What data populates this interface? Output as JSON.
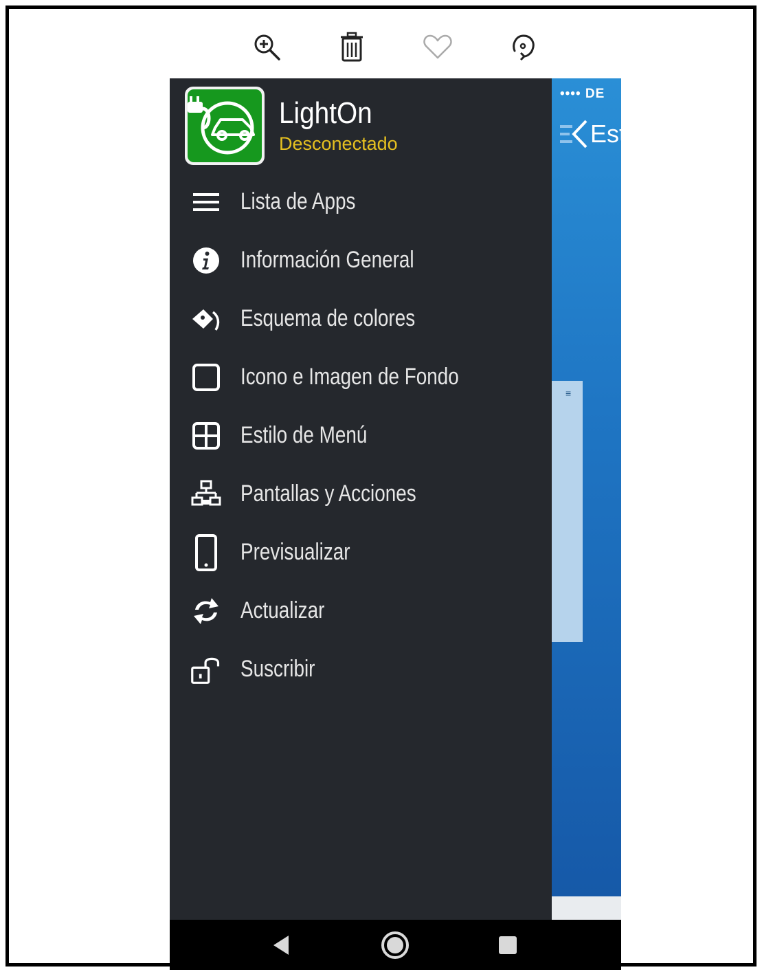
{
  "toolbar": {
    "zoom_icon": "zoom-in-icon",
    "delete_icon": "trash-icon",
    "favorite_icon": "heart-icon",
    "rotate_icon": "rotate-icon"
  },
  "app": {
    "name": "LightOn",
    "status": "Desconectado",
    "status_color": "#e5c020"
  },
  "menu": {
    "items": [
      {
        "label": "Lista de Apps",
        "icon": "list-icon"
      },
      {
        "label": "Información General",
        "icon": "info-icon"
      },
      {
        "label": "Esquema de colores",
        "icon": "paint-bucket-icon"
      },
      {
        "label": "Icono e Imagen de Fondo",
        "icon": "square-icon"
      },
      {
        "label": "Estilo de Menú",
        "icon": "grid-icon"
      },
      {
        "label": "Pantallas y Acciones",
        "icon": "sitemap-icon"
      },
      {
        "label": "Previsualizar",
        "icon": "mobile-phone-icon"
      },
      {
        "label": "Actualizar",
        "icon": "refresh-icon"
      },
      {
        "label": "Suscribir",
        "icon": "unlock-icon"
      }
    ]
  },
  "background_screen": {
    "status_text": "•••• DE",
    "back_label": "Est"
  },
  "colors": {
    "drawer_bg": "#25282d",
    "accent_blue": "#1f76c4",
    "logo_green": "#16981e"
  }
}
